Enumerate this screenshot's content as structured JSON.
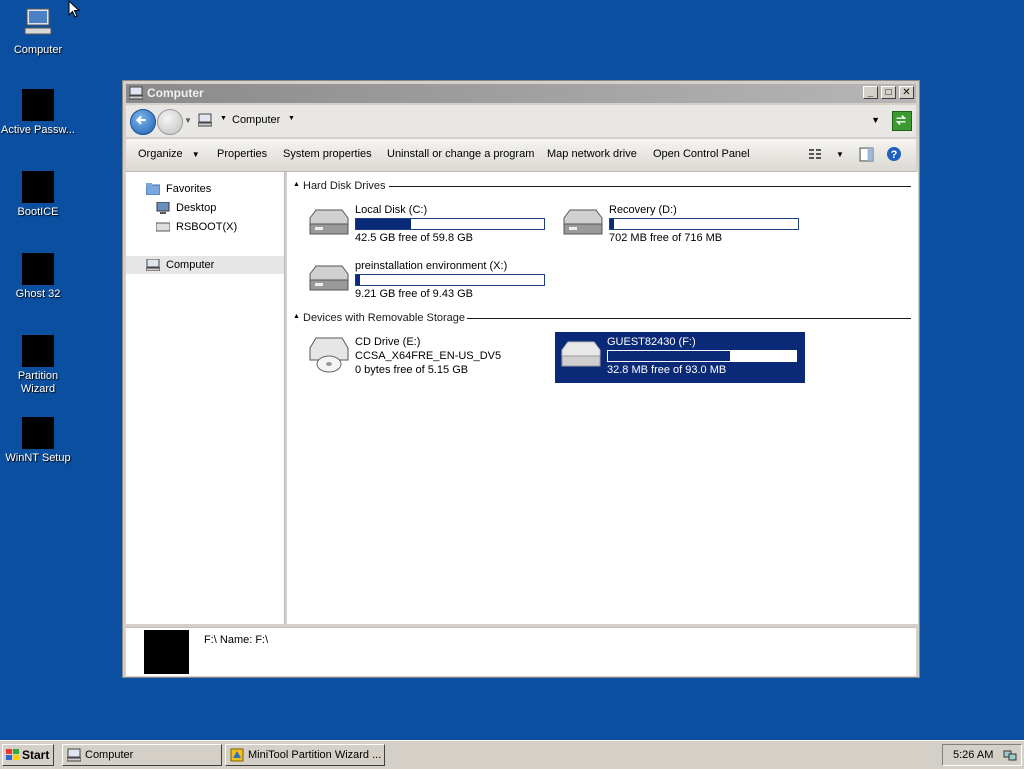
{
  "desktop": {
    "icons": [
      {
        "label": "Computer"
      },
      {
        "label": "Active Passw..."
      },
      {
        "label": "BootICE"
      },
      {
        "label": "Ghost 32"
      },
      {
        "label": "Partition Wizard"
      },
      {
        "label": "WinNT Setup"
      }
    ]
  },
  "window": {
    "title": "Computer",
    "address": {
      "path": "Computer"
    },
    "toolbar": {
      "organize": "Organize",
      "properties": "Properties",
      "system_properties": "System properties",
      "uninstall": "Uninstall or change a program",
      "map_drive": "Map network drive",
      "control_panel": "Open Control Panel"
    },
    "nav": {
      "favorites": "Favorites",
      "desktop": "Desktop",
      "rsboot": "RSBOOT(X)",
      "computer": "Computer"
    },
    "groups": {
      "hdd": "Hard Disk Drives",
      "removable": "Devices with Removable Storage"
    },
    "drives": [
      {
        "name": "Local Disk (C:)",
        "free": "42.5 GB free of 59.8 GB",
        "used_fraction": 0.29
      },
      {
        "name": "Recovery (D:)",
        "free": "702 MB free of 716 MB",
        "used_fraction": 0.02
      },
      {
        "name": "preinstallation environment (X:)",
        "free": "9.21 GB free of 9.43 GB",
        "used_fraction": 0.02
      },
      {
        "name": "GUEST82430 (F:)",
        "free": "32.8 MB free of 93.0 MB",
        "used_fraction": 0.65
      }
    ],
    "cd": {
      "name": "CD Drive (E:)",
      "label": "CCSA_X64FRE_EN-US_DV5",
      "free": "0 bytes free of 5.15 GB"
    },
    "details": {
      "text": "F:\\  Name: F:\\"
    }
  },
  "taskbar": {
    "start": "Start",
    "tasks": [
      {
        "label": "Computer"
      },
      {
        "label": "MiniTool Partition Wizard ..."
      }
    ],
    "clock": "5:26 AM"
  },
  "colors": {
    "desktop": "#0b4fa0",
    "bar_fill": "#0a2a78",
    "selection": "#0a2a78"
  }
}
